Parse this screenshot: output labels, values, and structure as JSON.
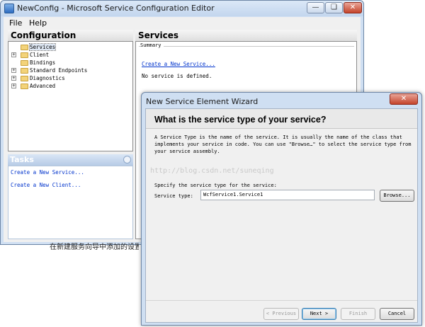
{
  "main_window": {
    "title": "NewConfig - Microsoft Service Configuration Editor",
    "menu": [
      "File",
      "Help"
    ],
    "configuration": {
      "title": "Configuration",
      "tree": [
        {
          "label": "Services",
          "expandable": false,
          "selected": true
        },
        {
          "label": "Client",
          "expandable": true
        },
        {
          "label": "Bindings",
          "expandable": false
        },
        {
          "label": "Standard Endpoints",
          "expandable": true
        },
        {
          "label": "Diagnostics",
          "expandable": true
        },
        {
          "label": "Advanced",
          "expandable": true
        }
      ]
    },
    "tasks": {
      "title": "Tasks",
      "links": [
        "Create a New Service...",
        "Create a New Client..."
      ]
    },
    "services": {
      "title": "Services",
      "summary_label": "Summary",
      "create_link": "Create a New Service...",
      "empty_text": "No service is defined."
    },
    "behind_text": "在新建服务向导中添加的设置"
  },
  "wizard": {
    "title": "New Service Element Wizard",
    "heading": "What is the service type of your service?",
    "description": "A Service Type is the name of the service. It is usually the name of the class that implements your service in code. You can use \"Browse…\" to select the service type from your service assembly.",
    "watermark": "http://blog.csdn.net/suneqing",
    "specify_text": "Specify the service type for the service:",
    "service_type_label": "Service type:",
    "service_type_value": "WcfService1.Service1",
    "buttons": {
      "browse": "Browse...",
      "previous": "< Previous",
      "next": "Next >",
      "finish": "Finish",
      "cancel": "Cancel"
    }
  }
}
